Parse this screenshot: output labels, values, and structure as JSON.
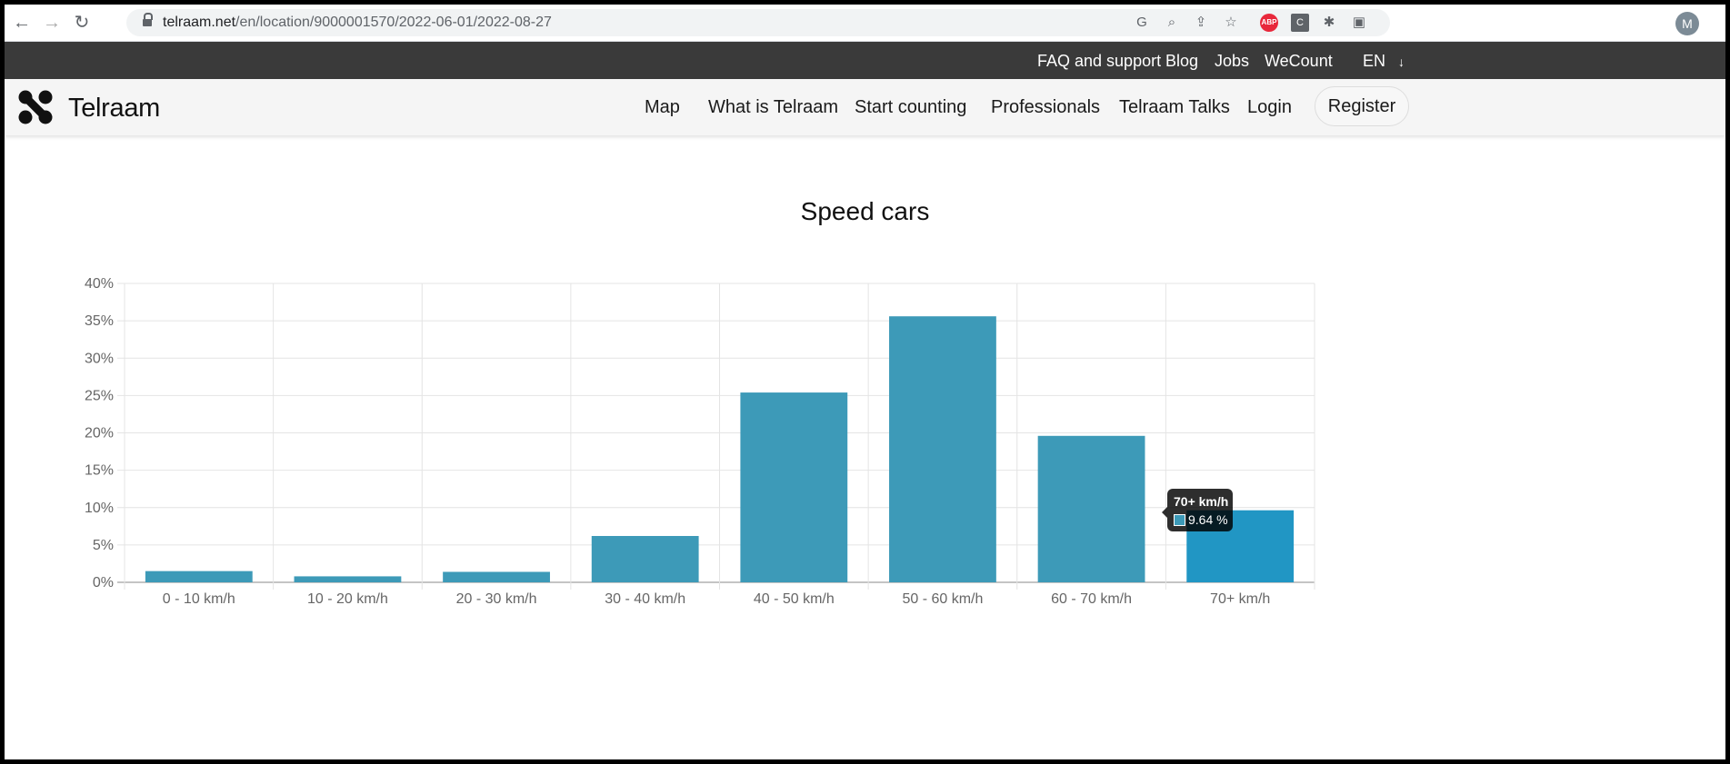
{
  "browser": {
    "url_host": "telraam.net",
    "url_path": "/en/location/9000001570/2022-06-01/2022-08-27",
    "profile_initial": "M",
    "extensions": [
      {
        "name": "translate-icon",
        "label": "G"
      },
      {
        "name": "zoom-icon",
        "label": "⌕"
      },
      {
        "name": "share-icon",
        "label": "⇪"
      },
      {
        "name": "bookmark-star-icon",
        "label": "☆"
      },
      {
        "name": "adblock-plus-icon",
        "label": "ABP"
      },
      {
        "name": "c-extension-icon",
        "label": "C"
      },
      {
        "name": "puzzle-extensions-icon",
        "label": "✱"
      },
      {
        "name": "side-panel-icon",
        "label": "▣"
      }
    ]
  },
  "topbar": {
    "links": [
      "FAQ and support",
      "Blog",
      "Jobs",
      "WeCount"
    ],
    "language": "EN",
    "language_arrow": "↓"
  },
  "nav": {
    "brand": "Telraam",
    "links": [
      "Map",
      "What is Telraam",
      "Start counting",
      "Professionals",
      "Telraam Talks",
      "Login"
    ],
    "register": "Register"
  },
  "tooltip": {
    "title": "70+ km/h",
    "value": "9.64 %"
  },
  "chart_data": {
    "type": "bar",
    "title": "Speed cars",
    "categories": [
      "0 - 10 km/h",
      "10 - 20 km/h",
      "20 - 30 km/h",
      "30 - 40 km/h",
      "40 - 50 km/h",
      "50 - 60 km/h",
      "60 - 70 km/h",
      "70+ km/h"
    ],
    "values": [
      1.5,
      0.8,
      1.4,
      6.2,
      25.4,
      35.6,
      19.6,
      9.64
    ],
    "y_ticks": [
      "0%",
      "5%",
      "10%",
      "15%",
      "20%",
      "25%",
      "30%",
      "35%",
      "40%"
    ],
    "ylim": [
      0,
      40
    ],
    "grid": true,
    "bar_color": "#3d9ab8",
    "highlight_color": "#2196c4",
    "highlighted_index": 7
  }
}
